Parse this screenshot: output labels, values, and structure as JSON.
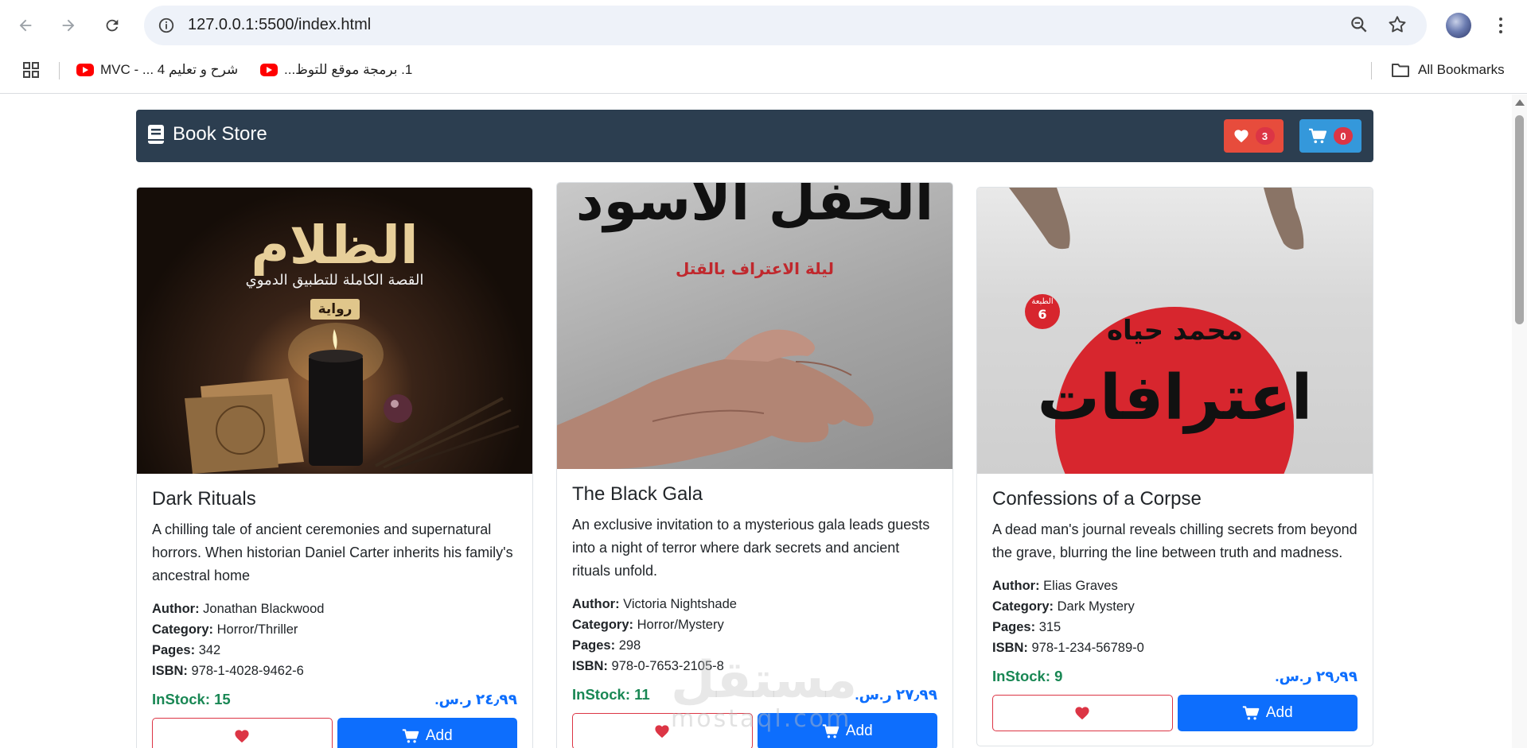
{
  "browser": {
    "url": "127.0.0.1:5500/index.html",
    "bookmarks": [
      {
        "label": "شرح و تعليم 4 ... - MVC",
        "icon": "youtube-icon"
      },
      {
        "label": "1. برمجة موقع للتوظ...",
        "icon": "youtube-icon"
      }
    ],
    "all_bookmarks_label": "All Bookmarks"
  },
  "navbar": {
    "brand": "Book Store",
    "favorites_count": "3",
    "cart_count": "0",
    "colors": {
      "navbar_bg": "#2c3e50",
      "favorites_bg": "#e74c3c",
      "cart_bg": "#3498db",
      "badge_bg": "#dc3545"
    }
  },
  "labels": {
    "author": "Author:",
    "category": "Category:",
    "pages": "Pages:",
    "isbn": "ISBN:",
    "add_button": "Add"
  },
  "books": [
    {
      "title": "Dark Rituals",
      "description": "A chilling tale of ancient ceremonies and supernatural horrors. When historian Daniel Carter inherits his family's ancestral home",
      "author": "Jonathan Blackwood",
      "category": "Horror/Thriller",
      "pages": "342",
      "isbn": "978-1-4028-9462-6",
      "stock": "InStock: 15",
      "price": "٢٤٫٩٩ ر.س.",
      "cover": {
        "title": "الظلام",
        "subtitle": "القصة الكاملة للتطبيق الدموي",
        "tag": "رواية"
      }
    },
    {
      "title": "The Black Gala",
      "description": "An exclusive invitation to a mysterious gala leads guests into a night of terror where dark secrets and ancient rituals unfold.",
      "author": "Victoria Nightshade",
      "category": "Horror/Mystery",
      "pages": "298",
      "isbn": "978-0-7653-2105-8",
      "stock": "InStock: 11",
      "price": "٢٧٫٩٩ ر.س.",
      "cover": {
        "title": "الحفل الأسود",
        "subtitle": "ليلة الاعتراف بالقتل"
      }
    },
    {
      "title": "Confessions of a Corpse",
      "description": "A dead man's journal reveals chilling secrets from beyond the grave, blurring the line between truth and madness.",
      "author": "Elias Graves",
      "category": "Dark Mystery",
      "pages": "315",
      "isbn": "978-1-234-56789-0",
      "stock": "InStock: 9",
      "price": "٢٩٫٩٩ ر.س.",
      "cover": {
        "author": "محمد حياه",
        "title": "اعترافات",
        "edition_label": "الطبعة",
        "edition": "6"
      }
    }
  ],
  "watermark": {
    "main": "مستقل",
    "sub": "mostaql.com"
  }
}
